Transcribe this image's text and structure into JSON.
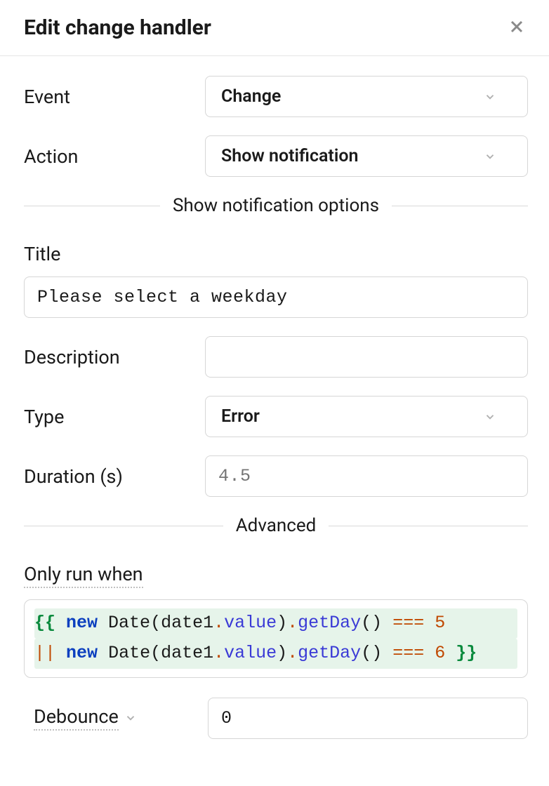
{
  "header": {
    "title": "Edit change handler"
  },
  "form": {
    "event": {
      "label": "Event",
      "value": "Change"
    },
    "action": {
      "label": "Action",
      "value": "Show notification"
    },
    "options_divider": "Show notification options",
    "title": {
      "label": "Title",
      "value": "Please select a weekday"
    },
    "description": {
      "label": "Description",
      "value": ""
    },
    "type": {
      "label": "Type",
      "value": "Error"
    },
    "duration": {
      "label": "Duration (s)",
      "placeholder": "4.5",
      "value": ""
    },
    "advanced_divider": "Advanced",
    "only_run_when": {
      "label": "Only run when",
      "expression_raw": "{{ new Date(date1.value).getDay() === 5 || new Date(date1.value).getDay() === 6 }}",
      "tokens_line1": [
        {
          "t": "{{ ",
          "cls": "tok-brace"
        },
        {
          "t": "new",
          "cls": "tok-kw"
        },
        {
          "t": " ",
          "cls": "tok-id"
        },
        {
          "t": "Date",
          "cls": "tok-id"
        },
        {
          "t": "(",
          "cls": "tok-punc"
        },
        {
          "t": "date1",
          "cls": "tok-id"
        },
        {
          "t": ".",
          "cls": "tok-dot"
        },
        {
          "t": "value",
          "cls": "tok-prop"
        },
        {
          "t": ")",
          "cls": "tok-punc"
        },
        {
          "t": ".",
          "cls": "tok-dot"
        },
        {
          "t": "getDay",
          "cls": "tok-prop"
        },
        {
          "t": "()",
          "cls": "tok-punc"
        },
        {
          "t": " === ",
          "cls": "tok-op"
        },
        {
          "t": "5",
          "cls": "tok-num"
        }
      ],
      "tokens_line2": [
        {
          "t": "||",
          "cls": "tok-op"
        },
        {
          "t": " ",
          "cls": "tok-id"
        },
        {
          "t": "new",
          "cls": "tok-kw"
        },
        {
          "t": " ",
          "cls": "tok-id"
        },
        {
          "t": "Date",
          "cls": "tok-id"
        },
        {
          "t": "(",
          "cls": "tok-punc"
        },
        {
          "t": "date1",
          "cls": "tok-id"
        },
        {
          "t": ".",
          "cls": "tok-dot"
        },
        {
          "t": "value",
          "cls": "tok-prop"
        },
        {
          "t": ")",
          "cls": "tok-punc"
        },
        {
          "t": ".",
          "cls": "tok-dot"
        },
        {
          "t": "getDay",
          "cls": "tok-prop"
        },
        {
          "t": "()",
          "cls": "tok-punc"
        },
        {
          "t": " === ",
          "cls": "tok-op"
        },
        {
          "t": "6",
          "cls": "tok-num"
        },
        {
          "t": " }}",
          "cls": "tok-brace"
        }
      ]
    },
    "debounce": {
      "label": "Debounce",
      "value": "0"
    }
  }
}
